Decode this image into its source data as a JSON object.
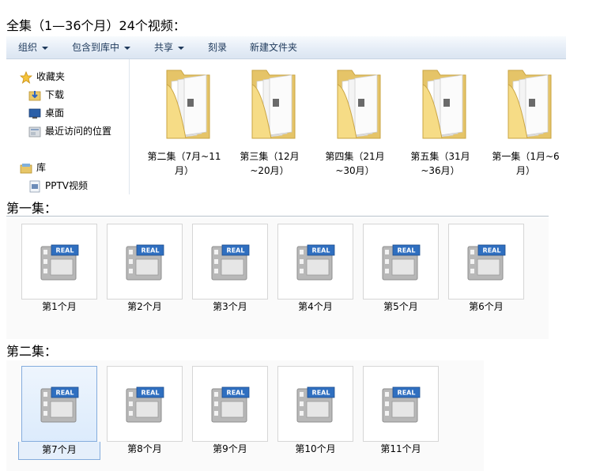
{
  "heading": "全集（1—36个月）24个视频：",
  "toolbar": {
    "organize": "组织",
    "include_library": "包含到库中",
    "share": "共享",
    "burn": "刻录",
    "new_folder": "新建文件夹"
  },
  "nav": {
    "favorites": "收藏夹",
    "downloads": "下载",
    "desktop": "桌面",
    "recent": "最近访问的位置",
    "libraries": "库",
    "pptv": "PPTV视频"
  },
  "folders": [
    {
      "line1": "第二集（7月~11",
      "line2": "月）"
    },
    {
      "line1": "第三集（12月",
      "line2": "~20月）"
    },
    {
      "line1": "第四集（21月",
      "line2": "~30月）"
    },
    {
      "line1": "第五集（31月",
      "line2": "~36月）"
    },
    {
      "line1": "第一集（1月~6",
      "line2": "月）"
    }
  ],
  "section1": {
    "title": "第一集：",
    "videos": [
      "第1个月",
      "第2个月",
      "第3个月",
      "第4个月",
      "第5个月",
      "第6个月"
    ]
  },
  "section2": {
    "title": "第二集：",
    "videos": [
      "第7个月",
      "第8个月",
      "第9个月",
      "第10个月",
      "第11个月"
    ]
  },
  "real_badge": "REAL",
  "colors": {
    "toolbar_text": "#1e395b",
    "folder_yellow": "#f2d77d",
    "real_blue": "#2f6fc0",
    "selection_border": "#84acdd"
  }
}
